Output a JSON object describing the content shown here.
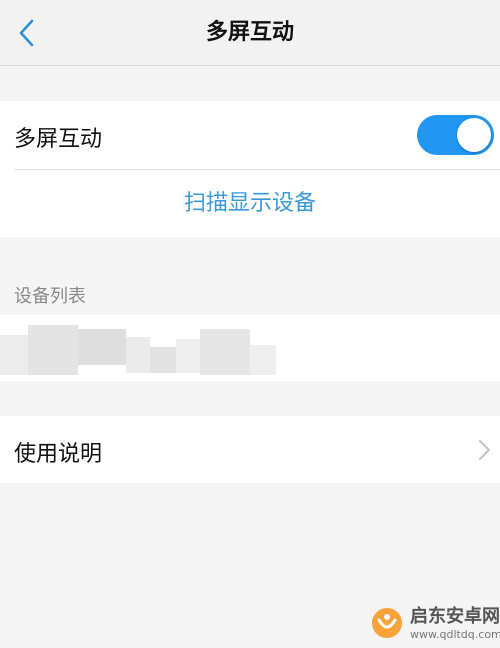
{
  "nav": {
    "title": "多屏互动",
    "back_icon": "chevron-left-icon"
  },
  "settings": {
    "multiscreen_label": "多屏互动",
    "multiscreen_enabled": true,
    "scan_label": "扫描显示设备"
  },
  "devices": {
    "section_label": "设备列表"
  },
  "help": {
    "label": "使用说明"
  },
  "watermark": {
    "text": "启东安卓网",
    "url": "www.qdltdq.com"
  },
  "colors": {
    "accent": "#2196f3",
    "link": "#3a9ad9",
    "background": "#f5f5f5"
  }
}
